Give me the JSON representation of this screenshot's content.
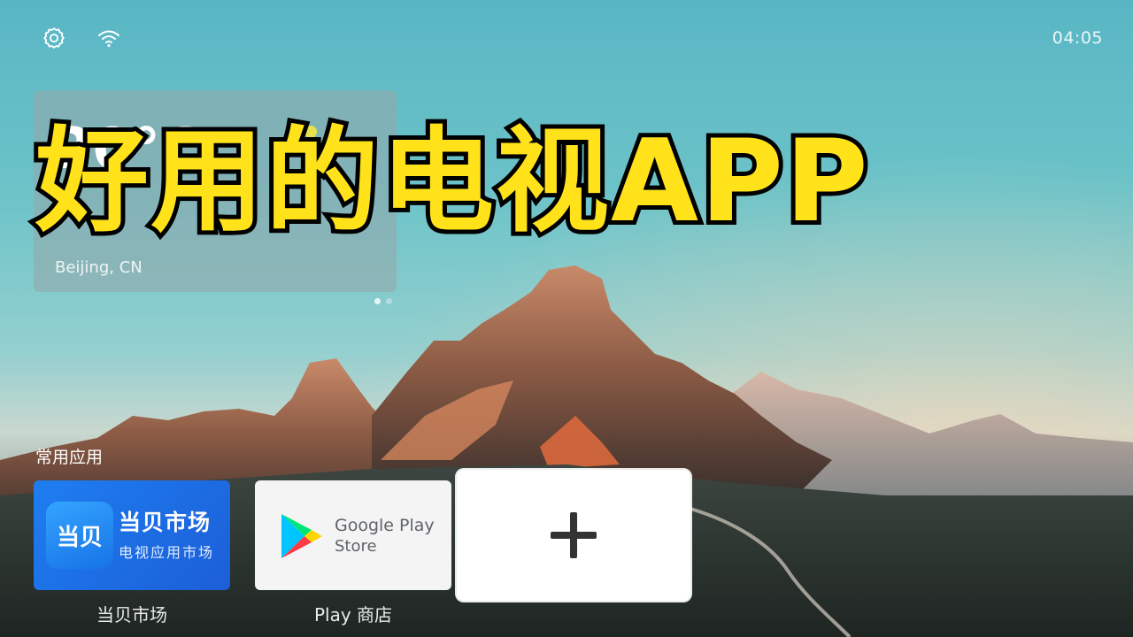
{
  "status_bar": {
    "settings_icon": "gear-icon",
    "wifi_icon": "wifi-icon",
    "time": "04:05"
  },
  "weather": {
    "temperature": "20°C",
    "location": "Beijing, CN",
    "page_dots": 2
  },
  "overlay": {
    "headline": "好用的电视APP"
  },
  "apps_section": {
    "label": "常用应用",
    "apps": [
      {
        "title": "当贝市场",
        "subtitle": "电视应用市场",
        "logo_text": "当贝",
        "caption": "当贝市场",
        "accent": "#1e6fe6"
      },
      {
        "line1": "Google Play",
        "line2": "Store",
        "caption": "Play 商店",
        "icon": "google-play-icon"
      },
      {
        "icon": "plus-icon"
      }
    ]
  },
  "colors": {
    "headline_fill": "#ffe21a",
    "headline_stroke": "#000000"
  }
}
